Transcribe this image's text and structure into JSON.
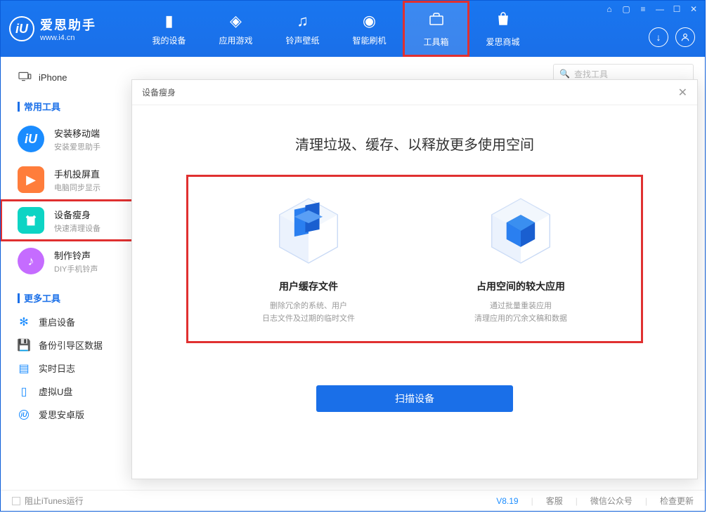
{
  "logo": {
    "title": "爱思助手",
    "url": "www.i4.cn",
    "badge": "iU"
  },
  "nav": [
    {
      "label": "我的设备"
    },
    {
      "label": "应用游戏"
    },
    {
      "label": "铃声壁纸"
    },
    {
      "label": "智能刷机"
    },
    {
      "label": "工具箱"
    },
    {
      "label": "爱思商城"
    }
  ],
  "sidebar": {
    "device": "iPhone",
    "section_common": "常用工具",
    "section_more": "更多工具",
    "tools": [
      {
        "title": "安装移动端",
        "desc": "安装爱思助手"
      },
      {
        "title": "手机投屏直",
        "desc": "电脑同步显示"
      },
      {
        "title": "设备瘦身",
        "desc": "快速清理设备"
      },
      {
        "title": "制作铃声",
        "desc": "DIY手机铃声"
      }
    ],
    "more": [
      {
        "label": "重启设备"
      },
      {
        "label": "备份引导区数据"
      },
      {
        "label": "实时日志"
      },
      {
        "label": "虚拟U盘"
      },
      {
        "label": "爱思安卓版"
      }
    ]
  },
  "search": {
    "placeholder": "查找工具"
  },
  "modal": {
    "title_bar": "设备瘦身",
    "heading": "清理垃圾、缓存、以释放更多使用空间",
    "option1": {
      "title": "用户缓存文件",
      "line1": "删除冗余的系统、用户",
      "line2": "日志文件及过期的临时文件"
    },
    "option2": {
      "title": "占用空间的较大应用",
      "line1": "通过批量重装应用",
      "line2": "清理应用的冗余文稿和数据"
    },
    "scan_btn": "扫描设备"
  },
  "status": {
    "itunes_block": "阻止iTunes运行",
    "version": "V8.19",
    "support": "客服",
    "wechat": "微信公众号",
    "update": "检查更新"
  }
}
